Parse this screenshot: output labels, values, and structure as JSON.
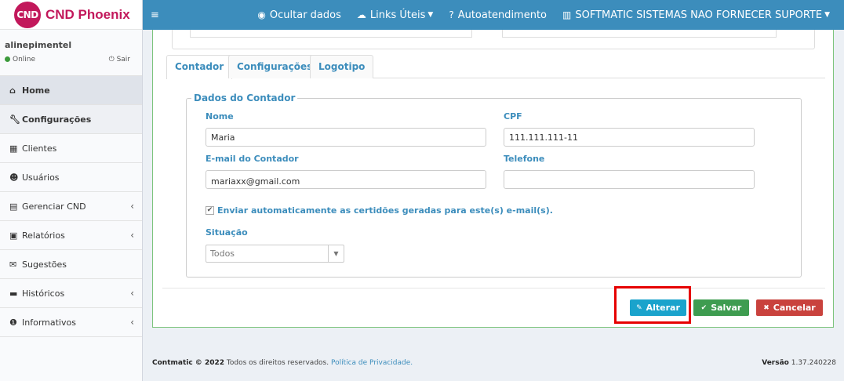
{
  "brand": {
    "logo_text": "CND",
    "name": "CND Phoenix",
    "color": "#c2185b"
  },
  "user": {
    "name": "alinepimentel",
    "status": "Online",
    "logout": "Sair"
  },
  "sidebar": {
    "items": [
      {
        "label": "Home",
        "icon": "home-icon",
        "chevron": ""
      },
      {
        "label": "Configurações",
        "icon": "wrench-icon",
        "chevron": ""
      },
      {
        "label": "Clientes",
        "icon": "building-icon",
        "chevron": ""
      },
      {
        "label": "Usuários",
        "icon": "user-icon",
        "chevron": ""
      },
      {
        "label": "Gerenciar CND",
        "icon": "calendar-icon",
        "chevron": "‹"
      },
      {
        "label": "Relatórios",
        "icon": "file-icon",
        "chevron": "‹"
      },
      {
        "label": "Sugestões",
        "icon": "comments-icon",
        "chevron": ""
      },
      {
        "label": "Históricos",
        "icon": "archive-icon",
        "chevron": "‹"
      },
      {
        "label": "Informativos",
        "icon": "info-icon",
        "chevron": "‹"
      }
    ]
  },
  "topnav": {
    "hide_data": "Ocultar dados",
    "links": "Links Úteis",
    "self_service": "Autoatendimento",
    "company": "SOFTMATIC SISTEMAS NAO FORNECER SUPORTE",
    "bar_color": "#3c8dbc"
  },
  "tabs": [
    {
      "label": "Contador"
    },
    {
      "label": "Configurações"
    },
    {
      "label": "Logotipo"
    }
  ],
  "form": {
    "legend": "Dados do Contador",
    "name_label": "Nome",
    "name_value": "Maria",
    "cpf_label": "CPF",
    "cpf_value": "111.111.111-11",
    "email_label": "E-mail do Contador",
    "email_value": "mariaxx@gmail.com",
    "phone_label": "Telefone",
    "phone_value": "",
    "auto_send_label": "Enviar automaticamente as certidões geradas para este(s) e-mail(s).",
    "auto_send_checked": true,
    "situation_label": "Situação",
    "situation_value": "Todos"
  },
  "actions": {
    "alter": "Alterar",
    "save": "Salvar",
    "cancel": "Cancelar"
  },
  "footer": {
    "copyright_brand": "Contmatic © 2022",
    "rights": "Todos os direitos reservados.",
    "privacy": "Política de Privacidade.",
    "version_label": "Versão",
    "version_value": "1.37.240228"
  }
}
